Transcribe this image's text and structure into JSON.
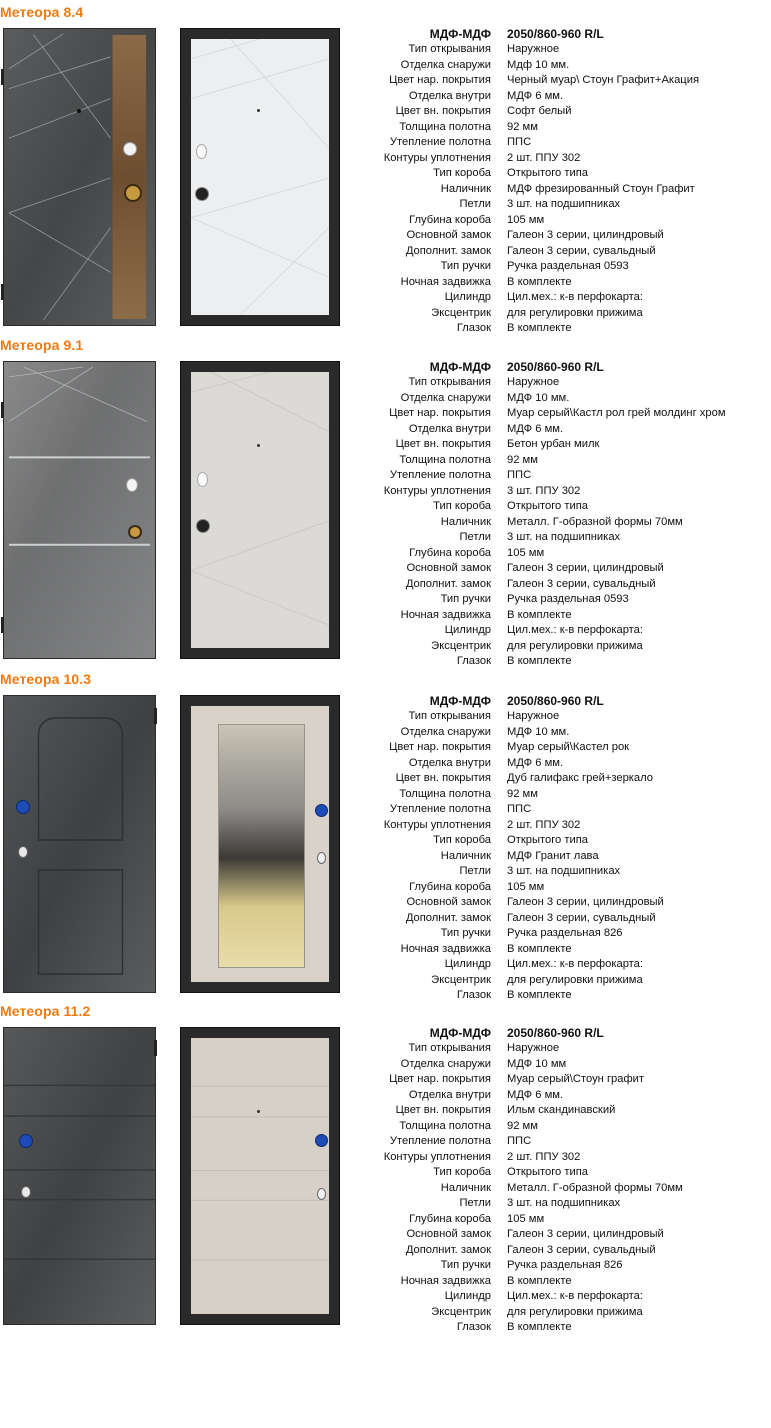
{
  "header": {
    "left": "МДФ-МДФ",
    "right": "2050/860-960  R/L"
  },
  "models": [
    {
      "title": "Метеора 8.4",
      "rows": [
        [
          "Тип открывания",
          "Наружное"
        ],
        [
          "Отделка снаружи",
          "Мдф 10 мм."
        ],
        [
          "Цвет нар. покрытия",
          "Черный муар\\ Стоун Графит+Акация"
        ],
        [
          "Отделка внутри",
          "МДФ 6 мм."
        ],
        [
          "Цвет вн. покрытия",
          "Софт белый"
        ],
        [
          "Толщина полотна",
          "92 мм"
        ],
        [
          "Утепление полотна",
          "ППС"
        ],
        [
          "Контуры уплотнения",
          " 2 шт. ППУ 302"
        ],
        [
          "Тип короба",
          "Открытого типа"
        ],
        [
          "Наличник",
          "МДФ фрезированный Стоун Графит"
        ],
        [
          "Петли",
          "3 шт. на подшипниках"
        ],
        [
          "Глубина короба",
          "105 мм"
        ],
        [
          "Основной замок",
          "Галеон 3 серии, цилиндровый"
        ],
        [
          "Дополнит. замок",
          "Галеон 3 серии, сувальдный"
        ],
        [
          "Тип ручки",
          "Ручка раздельная 0593"
        ],
        [
          "Ночная задвижка",
          "В комплекте"
        ],
        [
          "Цилиндр",
          "Цил.мех.: к-в перфокарта:"
        ],
        [
          "Эксцентрик",
          "для регулировки прижима"
        ],
        [
          "Глазок",
          "В комплекте"
        ]
      ]
    },
    {
      "title": "Метеора 9.1",
      "rows": [
        [
          "Тип открывания",
          "Наружное"
        ],
        [
          "Отделка снаружи",
          "МДФ 10 мм."
        ],
        [
          "Цвет нар. покрытия",
          "Муар серый\\Кастл рол грей молдинг хром"
        ],
        [
          "Отделка внутри",
          "МДФ 6 мм."
        ],
        [
          "Цвет вн. покрытия",
          "Бетон урбан милк"
        ],
        [
          "Толщина полотна",
          "92 мм"
        ],
        [
          "Утепление полотна",
          "ППС"
        ],
        [
          "Контуры уплотнения",
          "3 шт. ППУ 302"
        ],
        [
          "Тип короба",
          "Открытого типа"
        ],
        [
          "Наличник",
          "Металл. Г-образной формы 70мм"
        ],
        [
          "Петли",
          "3 шт. на подшипниках"
        ],
        [
          "Глубина короба",
          "105 мм"
        ],
        [
          "Основной замок",
          "Галеон 3 серии, цилиндровый"
        ],
        [
          "Дополнит. замок",
          "Галеон 3 серии, сувальдный"
        ],
        [
          "Тип ручки",
          "Ручка раздельная 0593"
        ],
        [
          "Ночная задвижка",
          "В комплекте"
        ],
        [
          "Цилиндр",
          "Цил.мех.: к-в перфокарта:"
        ],
        [
          "Эксцентрик",
          "для регулировки прижима"
        ],
        [
          "Глазок",
          "В комплекте"
        ]
      ]
    },
    {
      "title": "Метеора 10.3",
      "rows": [
        [
          "Тип открывания",
          "Наружное"
        ],
        [
          "Отделка снаружи",
          "МДФ 10 мм."
        ],
        [
          "Цвет нар. покрытия",
          "Муар серый\\Кастел рок"
        ],
        [
          "Отделка внутри",
          "МДФ 6 мм."
        ],
        [
          "Цвет вн. покрытия",
          "Дуб галифакс грей+зеркало"
        ],
        [
          "Толщина полотна",
          "92 мм"
        ],
        [
          "Утепление полотна",
          "ППС"
        ],
        [
          "Контуры уплотнения",
          "2 шт. ППУ 302"
        ],
        [
          "Тип короба",
          "Открытого типа"
        ],
        [
          "Наличник",
          "МДФ Гранит лава"
        ],
        [
          "Петли",
          "3 шт. на подшипниках"
        ],
        [
          "Глубина короба",
          "105 мм"
        ],
        [
          "Основной замок",
          "Галеон 3 серии, цилиндровый"
        ],
        [
          "Дополнит. замок",
          "Галеон 3 серии, сувальдный"
        ],
        [
          "Тип ручки",
          "Ручка раздельная 826"
        ],
        [
          "Ночная задвижка",
          "В комплекте"
        ],
        [
          "Цилиндр",
          "Цил.мех.: к-в перфокарта:"
        ],
        [
          "Эксцентрик",
          "для регулировки прижима"
        ],
        [
          "Глазок",
          "В комплекте"
        ]
      ]
    },
    {
      "title": "Метеора 11.2",
      "rows": [
        [
          "Тип открывания",
          "Наружное"
        ],
        [
          "Отделка снаружи",
          "МДФ 10 мм"
        ],
        [
          "Цвет нар. покрытия",
          "Муар серый\\Стоун графит"
        ],
        [
          "Отделка внутри",
          "МДФ 6 мм."
        ],
        [
          "Цвет вн. покрытия",
          "Ильм скандинавский"
        ],
        [
          "Толщина полотна",
          "92 мм"
        ],
        [
          "Утепление полотна",
          "ППС"
        ],
        [
          "Контуры уплотнения",
          "2 шт. ППУ 302"
        ],
        [
          "Тип короба",
          "Открытого типа"
        ],
        [
          "Наличник",
          "Металл. Г-образной формы 70мм"
        ],
        [
          "Петли",
          "3 шт. на подшипниках"
        ],
        [
          "Глубина короба",
          "105 мм"
        ],
        [
          "Основной замок",
          "Галеон 3 серии, цилиндровый"
        ],
        [
          "Дополнит. замок",
          "Галеон 3 серии, сувальдный"
        ],
        [
          "Тип ручки",
          "Ручка раздельная 826"
        ],
        [
          "Ночная задвижка",
          "В комплекте"
        ],
        [
          "Цилиндр",
          "Цил.мех.: к-в перфокарта:"
        ],
        [
          "Эксцентрик",
          "для регулировки прижима"
        ],
        [
          "Глазок",
          "В комплекте"
        ]
      ]
    }
  ],
  "colors": {
    "title_orange": "#f07a12",
    "concrete_dark": "#4b4d4f",
    "concrete_light": "#7a7b7c",
    "soft_white": "#eceeef",
    "urban_milk": "#dcdad6",
    "oak_grey": "#d8d2c8",
    "elm_light": "#d6d0c6",
    "acacia": "#7a5a3a",
    "lock_blue": "#1e4bb8"
  }
}
